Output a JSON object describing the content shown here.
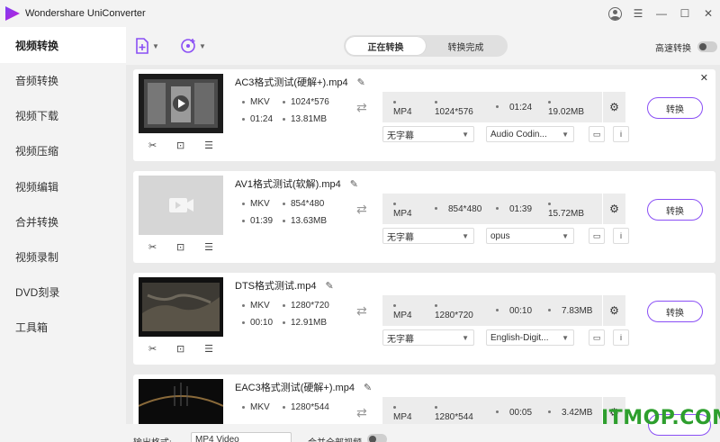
{
  "app": {
    "title": "Wondershare UniConverter",
    "accent_color": "#8a4ff5",
    "window_controls": {
      "user": "user-icon",
      "menu": "☰",
      "minimize": "—",
      "maximize": "☐",
      "close": "✕"
    }
  },
  "sidebar": {
    "items": [
      {
        "label": "视频转换",
        "active": true
      },
      {
        "label": "音频转换"
      },
      {
        "label": "视频下载"
      },
      {
        "label": "视频压缩"
      },
      {
        "label": "视频编辑"
      },
      {
        "label": "合并转换"
      },
      {
        "label": "视频录制"
      },
      {
        "label": "DVD刻录"
      },
      {
        "label": "工具箱"
      }
    ]
  },
  "toolbar": {
    "tabs": [
      {
        "label": "正在转换"
      },
      {
        "label": "转换完成"
      }
    ],
    "high_speed_label": "高速转换"
  },
  "files": [
    {
      "name": "AC3格式测试(硬解+).mp4",
      "src": {
        "format": "MKV",
        "resolution": "1024*576",
        "duration": "01:24",
        "size": "13.81MB"
      },
      "target": {
        "format": "MP4",
        "resolution": "1024*576",
        "duration": "01:24",
        "size": "19.02MB"
      },
      "subtitle": "无字幕",
      "audio": "Audio Codin...",
      "convert_label": "转换"
    },
    {
      "name": "AV1格式测试(软解).mp4",
      "src": {
        "format": "MKV",
        "resolution": "854*480",
        "duration": "01:39",
        "size": "13.63MB"
      },
      "target": {
        "format": "MP4",
        "resolution": "854*480",
        "duration": "01:39",
        "size": "15.72MB"
      },
      "subtitle": "无字幕",
      "audio": "opus",
      "convert_label": "转换"
    },
    {
      "name": "DTS格式测试.mp4",
      "src": {
        "format": "MKV",
        "resolution": "1280*720",
        "duration": "00:10",
        "size": "12.91MB"
      },
      "target": {
        "format": "MP4",
        "resolution": "1280*720",
        "duration": "00:10",
        "size": "7.83MB"
      },
      "subtitle": "无字幕",
      "audio": "English-Digit...",
      "convert_label": "转换"
    },
    {
      "name": "EAC3格式测试(硬解+).mp4",
      "src": {
        "format": "MKV",
        "resolution": "1280*544",
        "duration": "",
        "size": ""
      },
      "target": {
        "format": "MP4",
        "resolution": "1280*544",
        "duration": "00:05",
        "size": "3.42MB"
      },
      "subtitle": "",
      "audio": "",
      "convert_label": "转换"
    }
  ],
  "bottom": {
    "output_format_label": "输出格式:",
    "output_format_value": "MP4 Video",
    "merge_label": "合并全部视频"
  },
  "watermark": "ITMOP.COM"
}
